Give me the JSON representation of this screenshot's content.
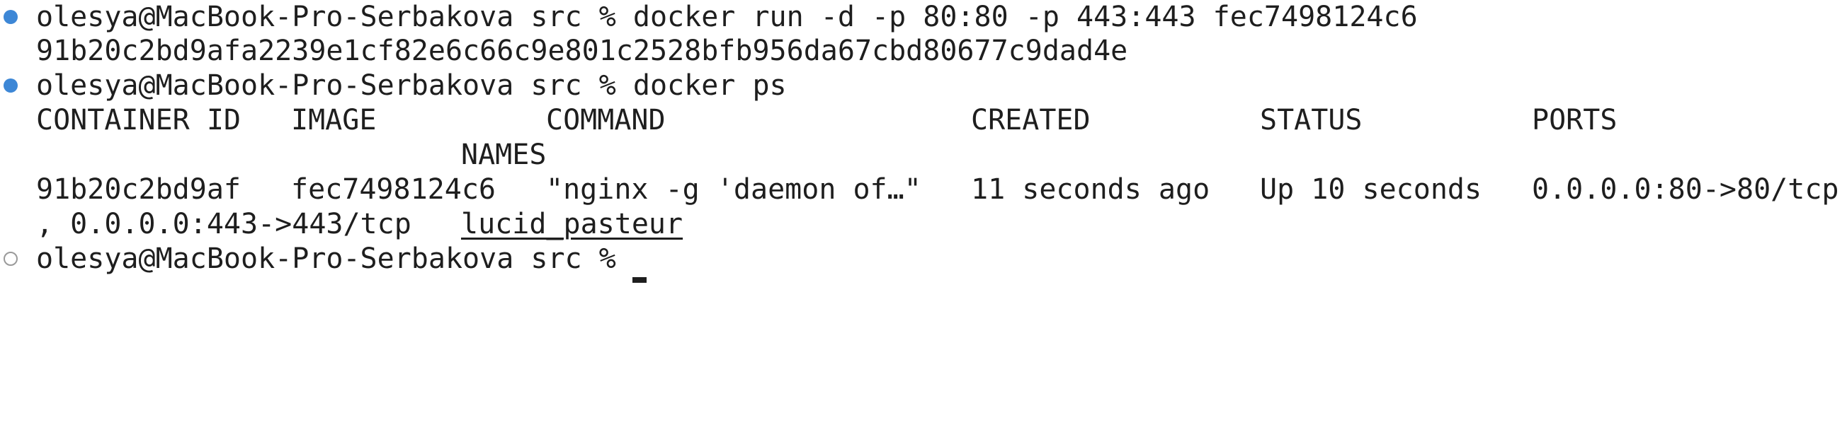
{
  "terminal": {
    "run_command": {
      "prompt": "olesya@MacBook-Pro-Serbakova src % ",
      "command": "docker run -d -p 80:80 -p 443:443 fec7498124c6"
    },
    "run_output": "91b20c2bd9afa2239e1cf82e6c66c9e801c2528bfb956da67cbd80677c9dad4e",
    "ps_command": {
      "prompt": "olesya@MacBook-Pro-Serbakova src % ",
      "command": "docker ps"
    },
    "ps_table": {
      "headers": {
        "container_id": "CONTAINER ID",
        "image": "IMAGE",
        "command": "COMMAND",
        "created": "CREATED",
        "status": "STATUS",
        "ports": "PORTS",
        "names": "NAMES"
      },
      "rows": [
        {
          "container_id": "91b20c2bd9af",
          "image": "fec7498124c6",
          "command": "\"nginx -g 'daemon of…\"",
          "created": "11 seconds ago",
          "status": "Up 10 seconds",
          "ports_line1": "0.0.0.0:80->80/tcp",
          "ports_line2": ", 0.0.0.0:443->443/tcp",
          "names": "lucid_pasteur"
        }
      ]
    },
    "current_prompt": "olesya@MacBook-Pro-Serbakova src %",
    "colors": {
      "background": "#ffffff",
      "text": "#1e1e1e",
      "success_mark": "#3d87d6",
      "idle_mark": "#9a9a9a"
    }
  }
}
